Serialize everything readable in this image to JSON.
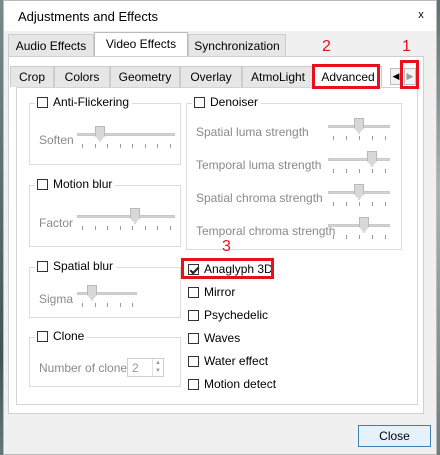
{
  "window": {
    "title": "Adjustments and Effects",
    "close_glyph": "x"
  },
  "main_tabs": [
    {
      "label": "Audio Effects"
    },
    {
      "label": "Video Effects"
    },
    {
      "label": "Synchronization"
    }
  ],
  "sub_tabs": [
    {
      "label": "Crop"
    },
    {
      "label": "Colors"
    },
    {
      "label": "Geometry"
    },
    {
      "label": "Overlay"
    },
    {
      "label": "AtmoLight"
    },
    {
      "label": "Advanced"
    }
  ],
  "annotations": {
    "one": "1",
    "two": "2",
    "three": "3"
  },
  "anti_flickering": {
    "label": "Anti-Flickering",
    "soften_label": "Soften",
    "checked": false,
    "value_fraction": 0.2
  },
  "motion_blur": {
    "label": "Motion blur",
    "factor_label": "Factor",
    "checked": false,
    "value_fraction": 0.6
  },
  "spatial_blur": {
    "label": "Spatial blur",
    "sigma_label": "Sigma",
    "checked": false,
    "value_fraction": 0.2
  },
  "clone": {
    "label": "Clone",
    "number_label": "Number of clones",
    "value": "2",
    "checked": false
  },
  "denoiser": {
    "label": "Denoiser",
    "checked": false,
    "items": [
      {
        "label": "Spatial luma strength",
        "value_fraction": 0.5
      },
      {
        "label": "Temporal luma strength",
        "value_fraction": 0.75
      },
      {
        "label": "Spatial chroma strength",
        "value_fraction": 0.5
      },
      {
        "label": "Temporal chroma strength",
        "value_fraction": 0.6
      }
    ]
  },
  "effects": [
    {
      "label": "Anaglyph 3D",
      "checked": true
    },
    {
      "label": "Mirror",
      "checked": false
    },
    {
      "label": "Psychedelic",
      "checked": false
    },
    {
      "label": "Waves",
      "checked": false
    },
    {
      "label": "Water effect",
      "checked": false
    },
    {
      "label": "Motion detect",
      "checked": false
    }
  ],
  "buttons": {
    "close": "Close"
  },
  "colors": {
    "annotation_red": "#e8101f",
    "focus_blue": "#3c7fb1"
  }
}
